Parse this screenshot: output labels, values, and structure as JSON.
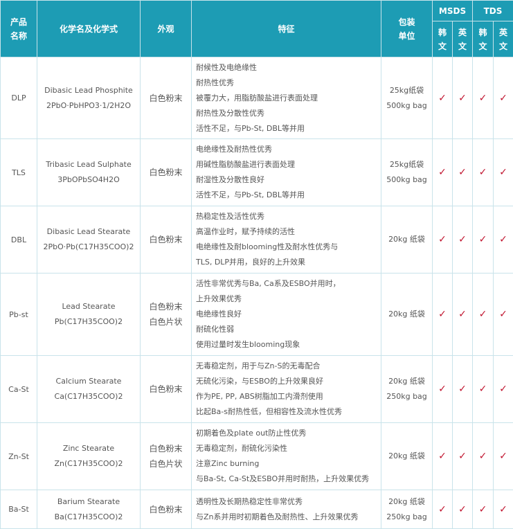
{
  "headers": {
    "name_1": "产品",
    "name_2": "名称",
    "chem": "化学名及化学式",
    "look": "外观",
    "feature": "特征",
    "pack_1": "包装",
    "pack_2": "单位",
    "msds": "MSDS",
    "tds": "TDS",
    "kr_1": "韩",
    "kr_2": "文",
    "en_1": "英",
    "en_2": "文"
  },
  "check_mark": "✓",
  "check_color": "#c0142e",
  "header_color": "#1d9cb4",
  "rows": [
    {
      "code": "DLP",
      "chem_name": "Dibasic Lead Phosphite",
      "formula": "2PbO·PbHPO3·1/2H2O",
      "look": [
        "白色粉末"
      ],
      "features": [
        "耐候性及电绝缘性",
        "耐热性优秀",
        "被覆力大，用脂肪酸盐进行表面处理",
        "耐热性及分散性优秀",
        "活性不足，与Pb-St, DBL等并用"
      ],
      "pack": [
        "25kg纸袋",
        "500kg bag"
      ]
    },
    {
      "code": "TLS",
      "chem_name": "Tribasic Lead Sulphate",
      "formula": "3PbOPbSO4H2O",
      "look": [
        "白色粉末"
      ],
      "features": [
        "电绝缘性及耐热性优秀",
        "用碱性脂肪酸盐进行表面处理",
        "耐湿性及分散性良好",
        "活性不足，与Pb-St, DBL等并用"
      ],
      "pack": [
        "25kg纸袋",
        "500kg bag"
      ]
    },
    {
      "code": "DBL",
      "chem_name": "Dibasic Lead Stearate",
      "formula": "2PbO·Pb(C17H35COO)2",
      "look": [
        "白色粉末"
      ],
      "features": [
        "热稳定性及活性优秀",
        "高温作业时，赋予持续的活性",
        "电绝缘性及耐blooming性及耐水性优秀与",
        "TLS, DLP并用，良好的上升效果"
      ],
      "pack": [
        "20kg 纸袋"
      ]
    },
    {
      "code": "Pb-st",
      "chem_name": "Lead Stearate",
      "formula": "Pb(C17H35COO)2",
      "look": [
        "白色粉末",
        "白色片状"
      ],
      "features": [
        "活性非常优秀与Ba, Ca系及ESBO并用时，",
        "上升效果优秀",
        "电绝缘性良好",
        "耐硫化性弱",
        "使用过量时发生blooming现象"
      ],
      "pack": [
        "20kg 纸袋"
      ]
    },
    {
      "code": "Ca-St",
      "chem_name": "Calcium Stearate",
      "formula": "Ca(C17H35COO)2",
      "look": [
        "白色粉末"
      ],
      "features": [
        "无毒稳定剂，用于与Zn-S的无毒配合",
        "无硫化污染，与ESBO的上升效果良好",
        "作为PE, PP, ABS树脂加工内滑剂使用",
        "比起Ba-s耐热性低，但相容性及流水性优秀"
      ],
      "pack": [
        "20kg 纸袋",
        "250kg bag"
      ]
    },
    {
      "code": "Zn-St",
      "chem_name": "Zinc Stearate",
      "formula": "Zn(C17H35COO)2",
      "look": [
        "白色粉末",
        "白色片状"
      ],
      "features": [
        "初期着色及plate out防止性优秀",
        "无毒稳定剂，耐硫化污染性",
        "注意Zinc burning",
        "与Ba-St, Ca-St及ESBO并用时耐热，上升效果优秀"
      ],
      "pack": [
        "20kg 纸袋"
      ]
    },
    {
      "code": "Ba-St",
      "chem_name": "Barium Stearate",
      "formula": "Ba(C17H35COO)2",
      "look": [
        "白色粉末"
      ],
      "features": [
        "透明性及长期热稳定性非常优秀",
        "与Zn系并用时初期着色及耐热性、上升效果优秀"
      ],
      "pack": [
        "20kg 纸袋",
        "250kg bag"
      ]
    }
  ]
}
